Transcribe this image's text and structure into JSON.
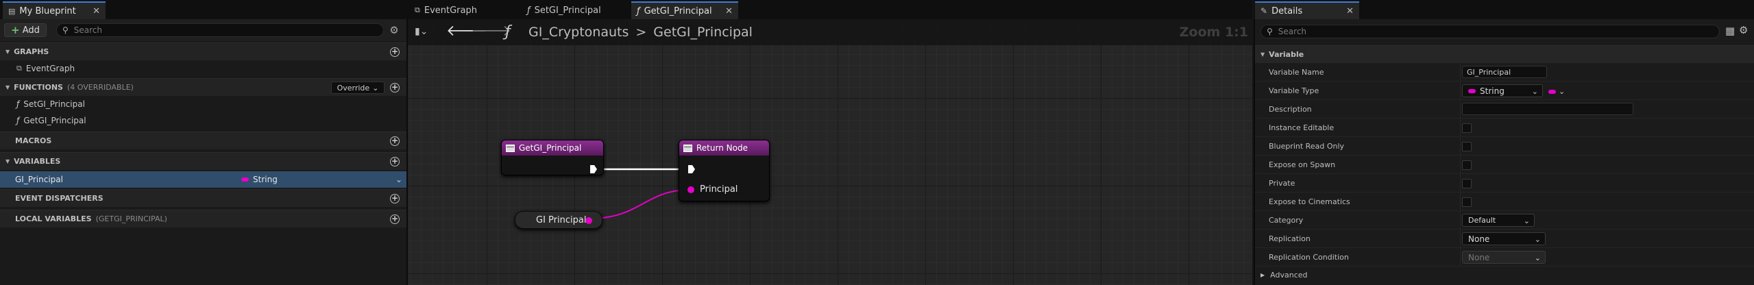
{
  "left_panel": {
    "tab_title": "My Blueprint",
    "add_label": "Add",
    "search_placeholder": "Search",
    "sections": {
      "graphs": "GRAPHS",
      "functions": "FUNCTIONS",
      "functions_sub": "(4 OVERRIDABLE)",
      "override_label": "Override",
      "macros": "MACROS",
      "variables": "VARIABLES",
      "event_dispatchers": "EVENT DISPATCHERS",
      "local_variables": "LOCAL VARIABLES",
      "local_variables_sub": "(GETGI_PRINCIPAL)"
    },
    "graph_items": [
      "EventGraph"
    ],
    "function_items": [
      "SetGI_Principal",
      "GetGI_Principal"
    ],
    "variable": {
      "name": "GI_Principal",
      "type": "String",
      "type_color": "#e600c8"
    }
  },
  "graph_tabs": [
    {
      "label": "EventGraph",
      "icon": "event-graph-icon"
    },
    {
      "label": "SetGI_Principal",
      "icon": "function-icon"
    },
    {
      "label": "GetGI_Principal",
      "icon": "function-icon",
      "active": true
    }
  ],
  "graph": {
    "breadcrumb_root": "GI_Cryptonauts",
    "breadcrumb_separator": ">",
    "breadcrumb_leaf": "GetGI_Principal",
    "zoom": "Zoom 1:1",
    "entry_node": {
      "title": "GetGI_Principal"
    },
    "return_node": {
      "title": "Return Node",
      "pin_label": "Principal"
    },
    "getter_node": {
      "label": "GI Principal"
    }
  },
  "details": {
    "tab_title": "Details",
    "search_placeholder": "Search",
    "section": "Variable",
    "rows": {
      "variable_name": {
        "label": "Variable Name",
        "value": "GI_Principal"
      },
      "variable_type": {
        "label": "Variable Type",
        "value": "String"
      },
      "description": {
        "label": "Description",
        "value": ""
      },
      "instance_editable": {
        "label": "Instance Editable",
        "checked": false
      },
      "blueprint_read_only": {
        "label": "Blueprint Read Only",
        "checked": false
      },
      "expose_on_spawn": {
        "label": "Expose on Spawn",
        "checked": false
      },
      "private": {
        "label": "Private",
        "checked": false
      },
      "expose_to_cinematics": {
        "label": "Expose to Cinematics",
        "checked": false
      },
      "category": {
        "label": "Category",
        "value": "Default"
      },
      "replication": {
        "label": "Replication",
        "value": "None"
      },
      "replication_condition": {
        "label": "Replication Condition",
        "value": "None"
      }
    },
    "advanced": "Advanced"
  },
  "colors": {
    "accent_blue": "#3b7fd6",
    "function_header": "#8a2f8f",
    "string_pin": "#e600c8",
    "selection": "#304d6c"
  }
}
